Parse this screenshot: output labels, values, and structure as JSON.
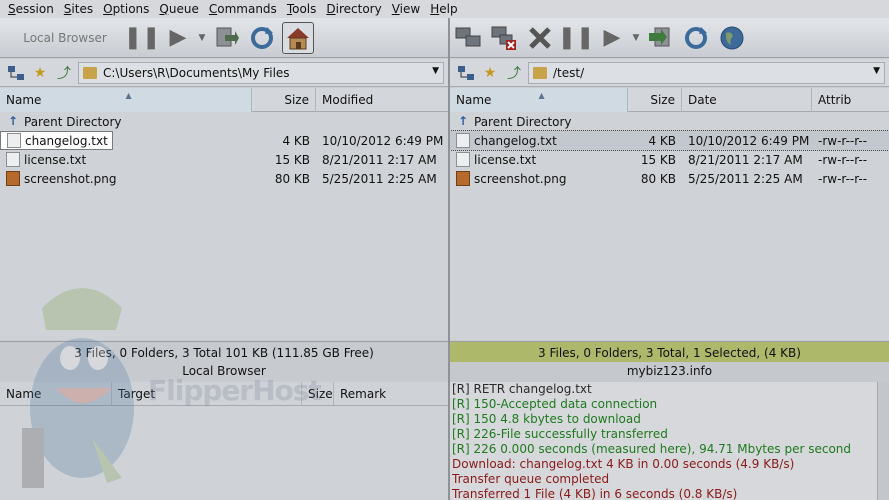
{
  "menu": [
    "Session",
    "Sites",
    "Options",
    "Queue",
    "Commands",
    "Tools",
    "Directory",
    "View",
    "Help"
  ],
  "toolbar_left": {
    "local_browser_label": "Local Browser"
  },
  "left_path": "C:\\Users\\R\\Documents\\My Files",
  "right_path": "/test/",
  "left_columns": [
    "Name",
    "Size",
    "Modified"
  ],
  "right_columns": [
    "Name",
    "Size",
    "Date",
    "Attrib"
  ],
  "left_files": [
    {
      "name": "Parent Directory",
      "size": "",
      "modified": "",
      "type": "up"
    },
    {
      "name": "changelog.txt",
      "size": "4 KB",
      "modified": "10/10/2012 6:49 PM",
      "type": "txt"
    },
    {
      "name": "license.txt",
      "size": "15 KB",
      "modified": "8/21/2011 2:17 AM",
      "type": "txt"
    },
    {
      "name": "screenshot.png",
      "size": "80 KB",
      "modified": "5/25/2011 2:25 AM",
      "type": "png"
    }
  ],
  "right_files": [
    {
      "name": "Parent Directory",
      "size": "",
      "date": "",
      "attrib": "",
      "type": "up"
    },
    {
      "name": "changelog.txt",
      "size": "4 KB",
      "date": "10/10/2012 6:49 PM",
      "attrib": "-rw-r--r--",
      "type": "txt"
    },
    {
      "name": "license.txt",
      "size": "15 KB",
      "date": "8/21/2011 2:17 AM",
      "attrib": "-rw-r--r--",
      "type": "txt"
    },
    {
      "name": "screenshot.png",
      "size": "80 KB",
      "date": "5/25/2011 2:25 AM",
      "attrib": "-rw-r--r--",
      "type": "png"
    }
  ],
  "left_status": {
    "summary": "3 Files, 0 Folders, 3 Total 101 KB (111.85 GB Free)",
    "label": "Local Browser"
  },
  "right_status": {
    "summary": "3 Files, 0 Folders, 3 Total, 1 Selected, (4 KB)",
    "label": "mybiz123.info"
  },
  "queue_columns": [
    "Name",
    "Target",
    "Size",
    "Remark"
  ],
  "log": [
    {
      "text": "[R] RETR changelog.txt",
      "color": "#2a2a2a"
    },
    {
      "text": "[R] 150-Accepted data connection",
      "color": "#1f7a1f"
    },
    {
      "text": "[R] 150 4.8 kbytes to download",
      "color": "#1f7a1f"
    },
    {
      "text": "[R] 226-File successfully transferred",
      "color": "#1f7a1f"
    },
    {
      "text": "[R] 226 0.000 seconds (measured here), 94.71 Mbytes per second",
      "color": "#1f7a1f"
    },
    {
      "text": "Download: changelog.txt 4 KB in 0.00 seconds (4.9 KB/s)",
      "color": "#8a1a1a"
    },
    {
      "text": "Transfer queue completed",
      "color": "#8a1a1a"
    },
    {
      "text": "Transferred 1 File (4 KB) in 6 seconds (0.8 KB/s)",
      "color": "#8a1a1a"
    }
  ],
  "watermark": "FlipperHost"
}
